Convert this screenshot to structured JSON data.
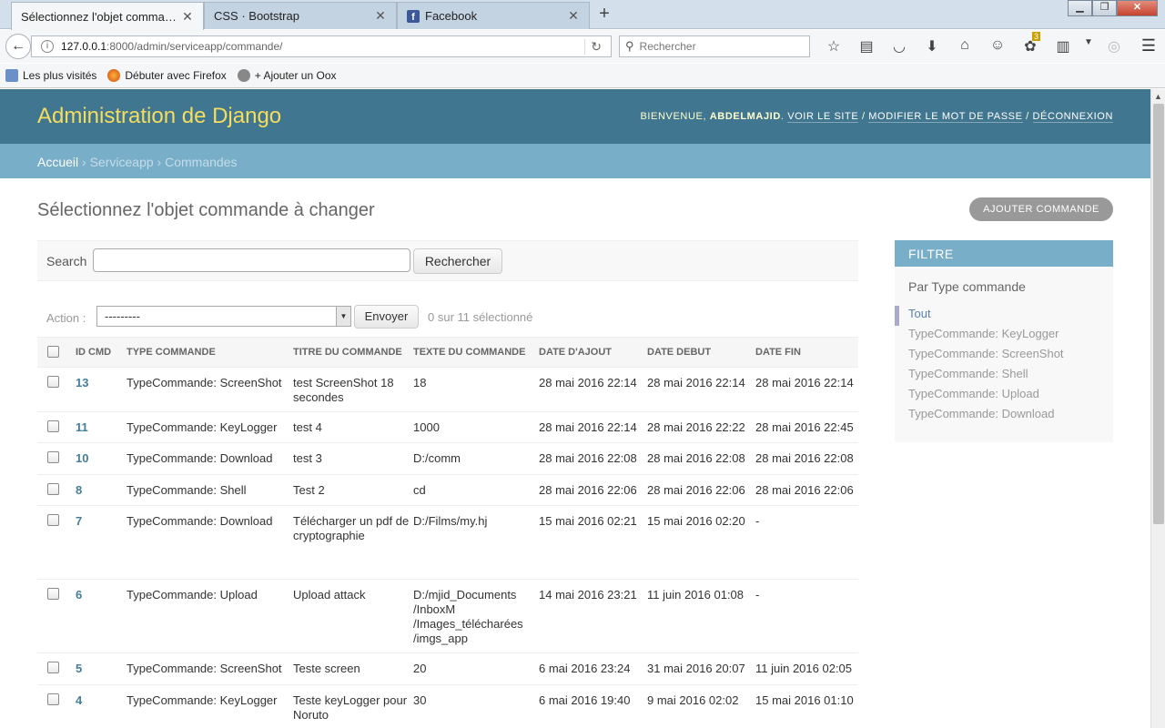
{
  "browser": {
    "tabs": [
      {
        "title": "Sélectionnez l'objet command...",
        "close": "✕"
      },
      {
        "title": "CSS · Bootstrap",
        "close": "✕"
      },
      {
        "title": "Facebook",
        "close": "✕"
      }
    ],
    "new_tab": "+",
    "url_host": "127.0.0.1",
    "url_path": ":8000/admin/serviceapp/commande/",
    "search_placeholder": "Rechercher",
    "addon_badge": "3",
    "bookmarks": [
      "Les plus visités",
      "Débuter avec Firefox",
      "+ Ajouter un Oox"
    ]
  },
  "header": {
    "site_name": "Administration de Django",
    "welcome": "Bienvenue,",
    "username": "abdelmajid",
    "view_site": "Voir le site",
    "change_password": "Modifier le mot de passe",
    "logout": "Déconnexion"
  },
  "breadcrumbs": {
    "home": "Accueil",
    "app": "Serviceapp",
    "model": "Commandes",
    "sep": "›"
  },
  "content": {
    "title": "Sélectionnez l'objet commande à changer",
    "add_button": "Ajouter commande"
  },
  "search": {
    "label": "Search",
    "value": "",
    "button": "Rechercher"
  },
  "actions": {
    "label": "Action :",
    "selected": "---------",
    "go": "Envoyer",
    "counter": "0 sur 11 sélectionné"
  },
  "table": {
    "headers": [
      "ID CMD",
      "Type commande",
      "Titre du commande",
      "Texte du commande",
      "Date d'ajout",
      "Date debut",
      "Date fin"
    ],
    "rows": [
      {
        "id": "13",
        "type": "TypeCommande: ScreenShot",
        "titre": "test ScreenShot 18 secondes",
        "texte": "18",
        "ajout": "28 mai 2016 22:14",
        "debut": "28 mai 2016 22:14",
        "fin": "28 mai 2016 22:14"
      },
      {
        "id": "11",
        "type": "TypeCommande: KeyLogger",
        "titre": "test 4",
        "texte": "1000",
        "ajout": "28 mai 2016 22:14",
        "debut": "28 mai 2016 22:22",
        "fin": "28 mai 2016 22:45"
      },
      {
        "id": "10",
        "type": "TypeCommande: Download",
        "titre": "test 3",
        "texte": "D:/comm",
        "ajout": "28 mai 2016 22:08",
        "debut": "28 mai 2016 22:08",
        "fin": "28 mai 2016 22:08"
      },
      {
        "id": "8",
        "type": "TypeCommande: Shell",
        "titre": "Test 2",
        "texte": "cd",
        "ajout": "28 mai 2016 22:06",
        "debut": "28 mai 2016 22:06",
        "fin": "28 mai 2016 22:06"
      },
      {
        "id": "7",
        "type": "TypeCommande: Download",
        "titre": "Télécharger un pdf de cryptographie",
        "texte": "D:/Films/my.hj",
        "ajout": "15 mai 2016 02:21",
        "debut": "15 mai 2016 02:20",
        "fin": "-"
      },
      {
        "id": "6",
        "type": "TypeCommande: Upload",
        "titre": "Upload attack",
        "texte": "D:/mjid_Documents /InboxM /Images_télécharées /imgs_app",
        "ajout": "14 mai 2016 23:21",
        "debut": "11 juin 2016 01:08",
        "fin": "-"
      },
      {
        "id": "5",
        "type": "TypeCommande: ScreenShot",
        "titre": "Teste screen",
        "texte": "20",
        "ajout": "6 mai 2016 23:24",
        "debut": "31 mai 2016 20:07",
        "fin": "11 juin 2016 02:05"
      },
      {
        "id": "4",
        "type": "TypeCommande: KeyLogger",
        "titre": "Teste keyLogger pour Noruto",
        "texte": "30",
        "ajout": "6 mai 2016 19:40",
        "debut": "9 mai 2016 02:02",
        "fin": "15 mai 2016 01:10"
      }
    ]
  },
  "filter": {
    "title": "Filtre",
    "subtitle": "Par Type commande",
    "options": [
      "Tout",
      "TypeCommande: KeyLogger",
      "TypeCommande: ScreenShot",
      "TypeCommande: Shell",
      "TypeCommande: Upload",
      "TypeCommande: Download"
    ],
    "selected_index": 0
  },
  "colors": {
    "header": "#417690",
    "breadcrumbs": "#79aec8",
    "site_name": "#f5dd5d",
    "link": "#447e9b"
  }
}
